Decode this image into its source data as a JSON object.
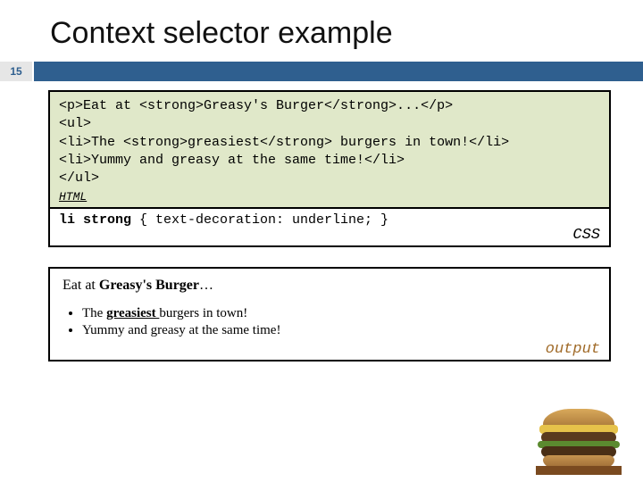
{
  "title": "Context selector example",
  "slide_number": "15",
  "code": {
    "line1": "<p>Eat at <strong>Greasy's Burger</strong>...</p>",
    "line2": "<ul>",
    "line3": "<li>The <strong>greasiest</strong> burgers in town!</li>",
    "line4": "<li>Yummy and greasy at the same time!</li>",
    "line5": "</ul>",
    "html_label": "HTML"
  },
  "css": {
    "selector": "li strong",
    "rule_body": " { text-decoration: underline; }",
    "label": "CSS"
  },
  "output": {
    "lead_pre": "Eat at ",
    "lead_strong": "Greasy's Burger",
    "lead_post": "…",
    "item1_pre": "The ",
    "item1_strong": "greasiest ",
    "item1_post": "burgers in town!",
    "item2": "Yummy and greasy at the same time!",
    "label": "output"
  }
}
